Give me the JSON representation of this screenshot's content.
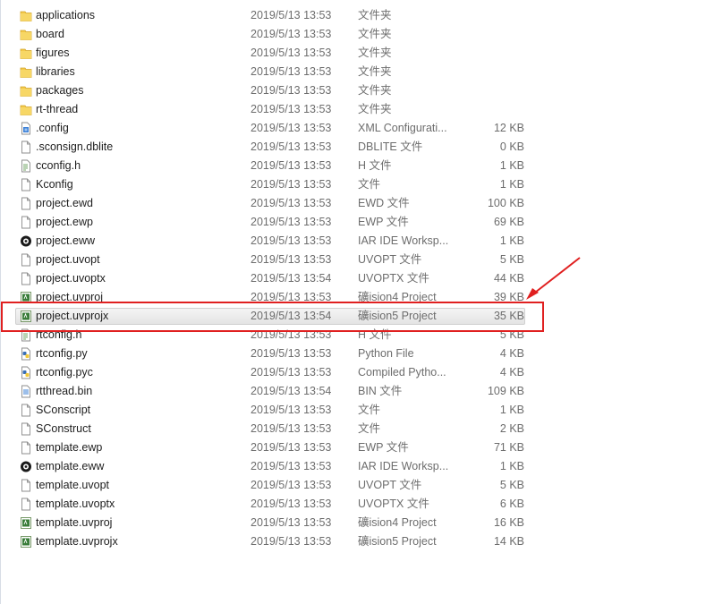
{
  "files": [
    {
      "name": "applications",
      "date": "2019/5/13 13:53",
      "type": "文件夹",
      "size": "",
      "icon": "folder-icon"
    },
    {
      "name": "board",
      "date": "2019/5/13 13:53",
      "type": "文件夹",
      "size": "",
      "icon": "folder-icon"
    },
    {
      "name": "figures",
      "date": "2019/5/13 13:53",
      "type": "文件夹",
      "size": "",
      "icon": "folder-icon"
    },
    {
      "name": "libraries",
      "date": "2019/5/13 13:53",
      "type": "文件夹",
      "size": "",
      "icon": "folder-icon"
    },
    {
      "name": "packages",
      "date": "2019/5/13 13:53",
      "type": "文件夹",
      "size": "",
      "icon": "folder-icon"
    },
    {
      "name": "rt-thread",
      "date": "2019/5/13 13:53",
      "type": "文件夹",
      "size": "",
      "icon": "folder-icon"
    },
    {
      "name": ".config",
      "date": "2019/5/13 13:53",
      "type": "XML Configurati...",
      "size": "12 KB",
      "icon": "xml-config-icon"
    },
    {
      "name": ".sconsign.dblite",
      "date": "2019/5/13 13:53",
      "type": "DBLITE 文件",
      "size": "0 KB",
      "icon": "blank-file-icon"
    },
    {
      "name": "cconfig.h",
      "date": "2019/5/13 13:53",
      "type": "H 文件",
      "size": "1 KB",
      "icon": "header-file-icon"
    },
    {
      "name": "Kconfig",
      "date": "2019/5/13 13:53",
      "type": "文件",
      "size": "1 KB",
      "icon": "blank-file-icon"
    },
    {
      "name": "project.ewd",
      "date": "2019/5/13 13:53",
      "type": "EWD 文件",
      "size": "100 KB",
      "icon": "blank-file-icon"
    },
    {
      "name": "project.ewp",
      "date": "2019/5/13 13:53",
      "type": "EWP 文件",
      "size": "69 KB",
      "icon": "blank-file-icon"
    },
    {
      "name": "project.eww",
      "date": "2019/5/13 13:53",
      "type": "IAR IDE Worksp...",
      "size": "1 KB",
      "icon": "iar-workspace-icon"
    },
    {
      "name": "project.uvopt",
      "date": "2019/5/13 13:53",
      "type": "UVOPT 文件",
      "size": "5 KB",
      "icon": "blank-file-icon"
    },
    {
      "name": "project.uvoptx",
      "date": "2019/5/13 13:54",
      "type": "UVOPTX 文件",
      "size": "44 KB",
      "icon": "blank-file-icon"
    },
    {
      "name": "project.uvproj",
      "date": "2019/5/13 13:53",
      "type": "礦ision4 Project",
      "size": "39 KB",
      "icon": "keil-project-icon"
    },
    {
      "name": "project.uvprojx",
      "date": "2019/5/13 13:54",
      "type": "礦ision5 Project",
      "size": "35 KB",
      "icon": "keil-project-icon",
      "selected": true
    },
    {
      "name": "rtconfig.h",
      "date": "2019/5/13 13:53",
      "type": "H 文件",
      "size": "5 KB",
      "icon": "header-file-icon"
    },
    {
      "name": "rtconfig.py",
      "date": "2019/5/13 13:53",
      "type": "Python File",
      "size": "4 KB",
      "icon": "python-file-icon"
    },
    {
      "name": "rtconfig.pyc",
      "date": "2019/5/13 13:53",
      "type": "Compiled Pytho...",
      "size": "4 KB",
      "icon": "python-compiled-icon"
    },
    {
      "name": "rtthread.bin",
      "date": "2019/5/13 13:54",
      "type": "BIN 文件",
      "size": "109 KB",
      "icon": "binary-file-icon"
    },
    {
      "name": "SConscript",
      "date": "2019/5/13 13:53",
      "type": "文件",
      "size": "1 KB",
      "icon": "blank-file-icon"
    },
    {
      "name": "SConstruct",
      "date": "2019/5/13 13:53",
      "type": "文件",
      "size": "2 KB",
      "icon": "blank-file-icon"
    },
    {
      "name": "template.ewp",
      "date": "2019/5/13 13:53",
      "type": "EWP 文件",
      "size": "71 KB",
      "icon": "blank-file-icon"
    },
    {
      "name": "template.eww",
      "date": "2019/5/13 13:53",
      "type": "IAR IDE Worksp...",
      "size": "1 KB",
      "icon": "iar-workspace-icon"
    },
    {
      "name": "template.uvopt",
      "date": "2019/5/13 13:53",
      "type": "UVOPT 文件",
      "size": "5 KB",
      "icon": "blank-file-icon"
    },
    {
      "name": "template.uvoptx",
      "date": "2019/5/13 13:53",
      "type": "UVOPTX 文件",
      "size": "6 KB",
      "icon": "blank-file-icon"
    },
    {
      "name": "template.uvproj",
      "date": "2019/5/13 13:53",
      "type": "礦ision4 Project",
      "size": "16 KB",
      "icon": "keil-project-icon"
    },
    {
      "name": "template.uvprojx",
      "date": "2019/5/13 13:53",
      "type": "礦ision5 Project",
      "size": "14 KB",
      "icon": "keil-project-icon"
    }
  ],
  "colors": {
    "annotation": "#e02020",
    "folder": "#f3c94a",
    "selection": "#e8e8e8"
  }
}
